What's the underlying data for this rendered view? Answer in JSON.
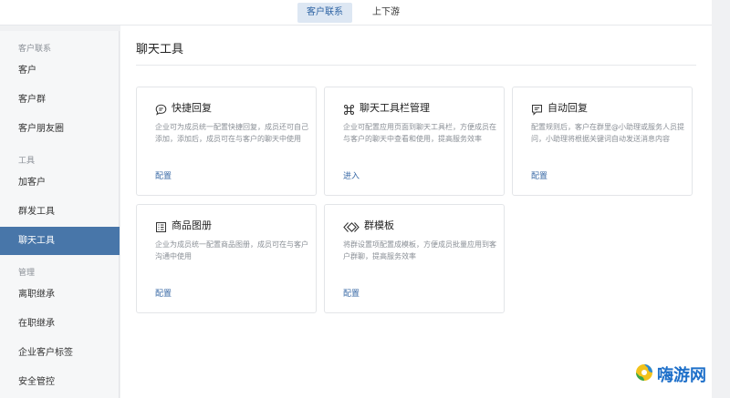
{
  "top_tabs": [
    {
      "label": "客户联系",
      "active": true
    },
    {
      "label": "上下游",
      "active": false
    }
  ],
  "sidebar": {
    "groups": [
      {
        "label": "客户联系"
      },
      {
        "label": "工具"
      },
      {
        "label": "管理"
      }
    ],
    "items": [
      {
        "label": "客户"
      },
      {
        "label": "客户群"
      },
      {
        "label": "客户朋友圈"
      },
      {
        "label": "加客户"
      },
      {
        "label": "群发工具"
      },
      {
        "label": "聊天工具",
        "active": true
      },
      {
        "label": "离职继承"
      },
      {
        "label": "在职继承"
      },
      {
        "label": "企业客户标签"
      },
      {
        "label": "安全管控"
      }
    ]
  },
  "main": {
    "title": "聊天工具",
    "cards": [
      {
        "icon": "chat-bubble-icon",
        "title": "快捷回复",
        "desc": "企业可为成员统一配置快捷回复，成员还可自己添加，添加后，成员可在与客户的聊天中使用",
        "action": "配置"
      },
      {
        "icon": "command-icon",
        "title": "聊天工具栏管理",
        "desc": "企业可配置应用页面到聊天工具栏，方便成员在与客户的聊天中查看和使用，提高服务效率",
        "action": "进入"
      },
      {
        "icon": "auto-reply-icon",
        "title": "自动回复",
        "desc": "配置规则后，客户在群里@小助理或服务人员提问，小助理将根据关键词自动发送消息内容",
        "action": "配置"
      },
      {
        "icon": "catalog-icon",
        "title": "商品图册",
        "desc": "企业为成员统一配置商品图册，成员可在与客户沟通中使用",
        "action": "配置"
      },
      {
        "icon": "template-icon",
        "title": "群模板",
        "desc": "将群设置项配置成模板，方便成员批量应用到客户群聊，提高服务效率",
        "action": "配置"
      }
    ]
  },
  "watermark": {
    "text": "嗨游网",
    "icon": "swirl-logo-icon"
  },
  "colors": {
    "accent": "#4876a9",
    "link": "#3a6aa6",
    "tab_active_bg": "#dde7f3"
  }
}
